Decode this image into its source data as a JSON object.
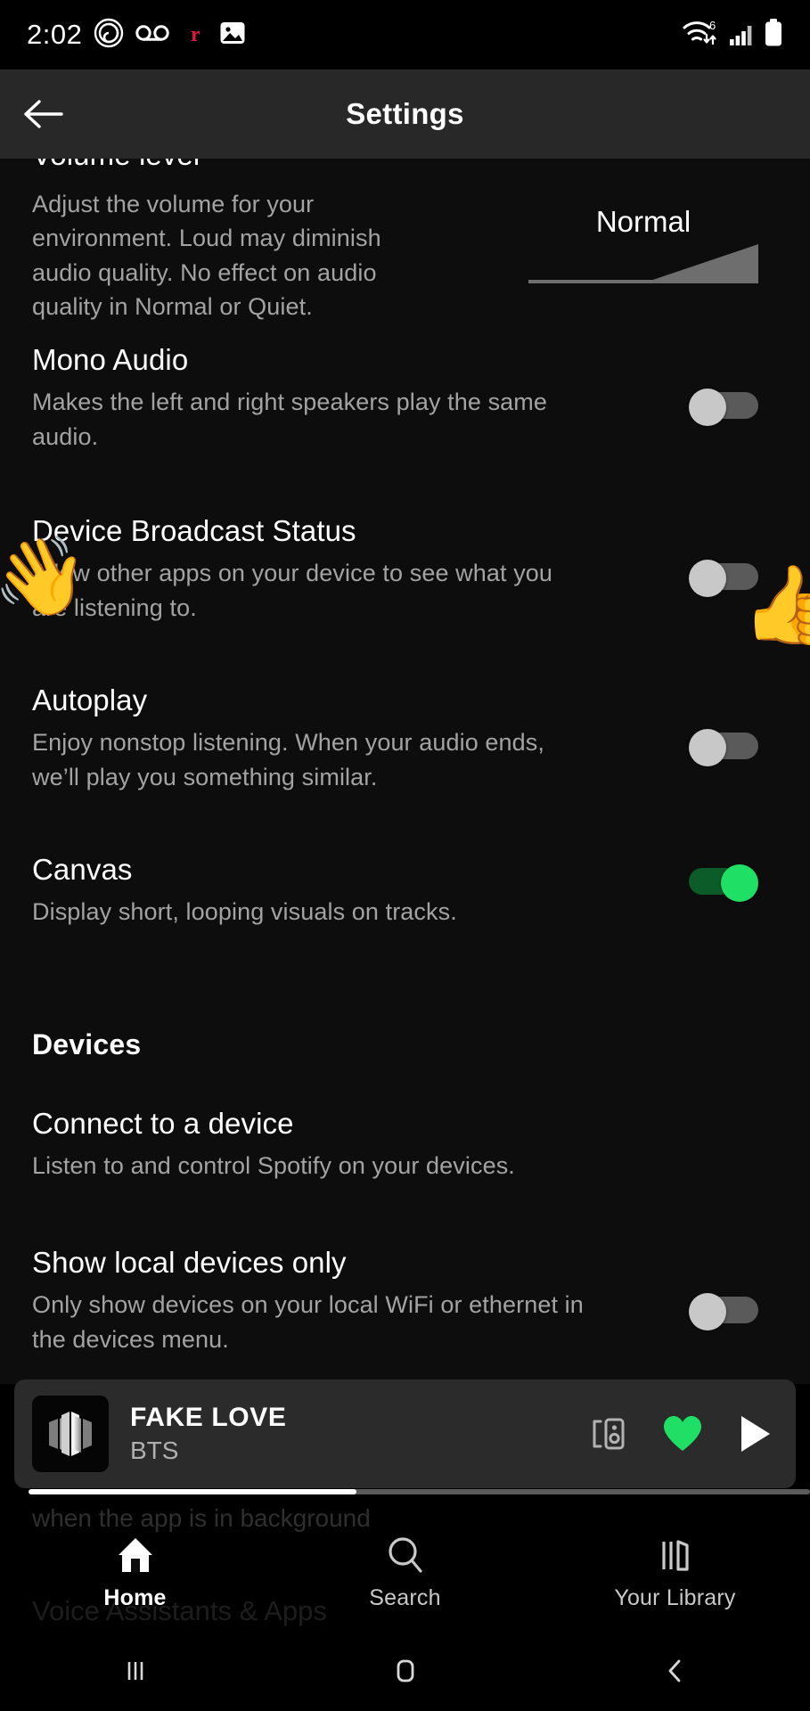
{
  "status_bar": {
    "time": "2:02",
    "left_icons": [
      "spiral-icon",
      "voicemail-icon",
      "reddit-icon",
      "image-icon"
    ],
    "reddit_letter": "r",
    "right_icons": [
      "wifi-6-icon",
      "cellular-signal-icon",
      "battery-full-icon"
    ],
    "wifi_generation": "6"
  },
  "app_bar": {
    "title": "Settings",
    "back_icon": "arrow-left-icon"
  },
  "settings": {
    "volume_level": {
      "title": "Volume level",
      "description": "Adjust the volume for your environment. Loud may diminish audio quality. No effect on audio quality in Normal or Quiet.",
      "value": "Normal"
    },
    "items": [
      {
        "id": "mono-audio",
        "title": "Mono Audio",
        "description": "Makes the left and right speakers play the same audio.",
        "toggle": "off"
      },
      {
        "id": "device-broadcast-status",
        "title": "Device Broadcast Status",
        "description": "Allow other apps on your device to see what you are listening to.",
        "toggle": "off"
      },
      {
        "id": "autoplay",
        "title": "Autoplay",
        "description": "Enjoy nonstop listening. When your audio ends, we’ll play you something similar.",
        "toggle": "off"
      },
      {
        "id": "canvas",
        "title": "Canvas",
        "description": "Display short, looping visuals on tracks.",
        "toggle": "on"
      }
    ],
    "devices_section": {
      "heading": "Devices",
      "items": [
        {
          "id": "connect-to-a-device",
          "title": "Connect to a device",
          "description": "Listen to and control Spotify on your devices.",
          "toggle": null
        },
        {
          "id": "show-local-devices-only",
          "title": "Show local devices only",
          "description": "Only show devices on your local WiFi or ethernet in the devices menu.",
          "toggle": "off"
        }
      ]
    },
    "background_text": {
      "line1": "when the app is in background",
      "line2": "Voice Assistants & Apps"
    }
  },
  "annotations": {
    "left_emoji": "👋",
    "right_emoji": "👍"
  },
  "now_playing": {
    "track": "FAKE LOVE",
    "artist": "BTS",
    "album_art": "bts-logo-art",
    "progress_percent": 42,
    "controls": [
      "connect-device-icon",
      "heart-filled-icon",
      "play-icon"
    ],
    "liked": true,
    "heart_color": "#1fdf64"
  },
  "tab_bar": {
    "tabs": [
      {
        "id": "home",
        "label": "Home",
        "icon": "home-icon",
        "active": true
      },
      {
        "id": "search",
        "label": "Search",
        "icon": "search-icon",
        "active": false
      },
      {
        "id": "library",
        "label": "Your Library",
        "icon": "library-icon",
        "active": false
      }
    ]
  },
  "nav_bar": {
    "buttons": [
      {
        "id": "recents",
        "icon": "recents-icon"
      },
      {
        "id": "home",
        "icon": "home-square-icon"
      },
      {
        "id": "back",
        "icon": "back-chevron-icon"
      }
    ]
  },
  "colors": {
    "background": "#0d0d0d",
    "appbar": "#282828",
    "accent_green": "#1fdf64",
    "toggle_off_track": "#5a5a5a",
    "toggle_off_knob": "#c8c8c8",
    "secondary_text": "#a3a3a3"
  }
}
